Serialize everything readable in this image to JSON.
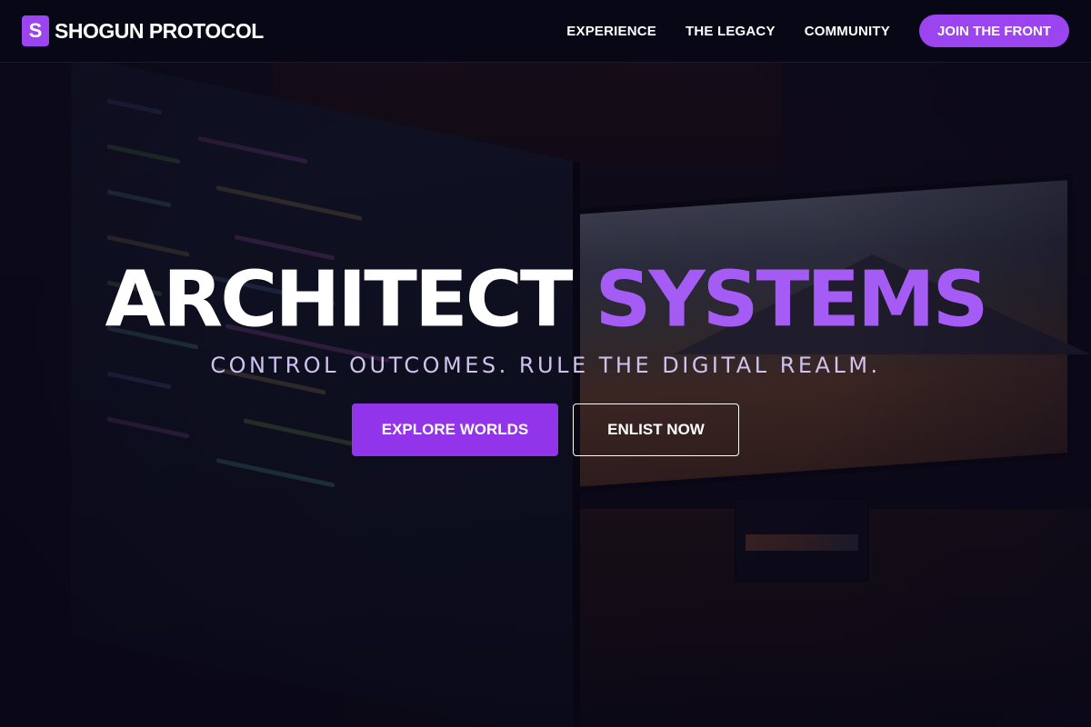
{
  "brand": {
    "mark": "S",
    "name": "SHOGUN PROTOCOL"
  },
  "nav": {
    "links": [
      "EXPERIENCE",
      "THE LEGACY",
      "COMMUNITY"
    ],
    "cta": "JOIN THE FRONT"
  },
  "hero": {
    "title_white": "ARCHITECT",
    "title_purple": "SYSTEMS",
    "subtitle": "CONTROL OUTCOMES. RULE THE DIGITAL REALM.",
    "primary_button": "EXPLORE WORLDS",
    "secondary_button": "ENLIST NOW"
  },
  "colors": {
    "accent": "#9b45f0",
    "accent_text": "#a55cf4",
    "background": "#0a0818",
    "subtitle": "#cfc3ee"
  }
}
